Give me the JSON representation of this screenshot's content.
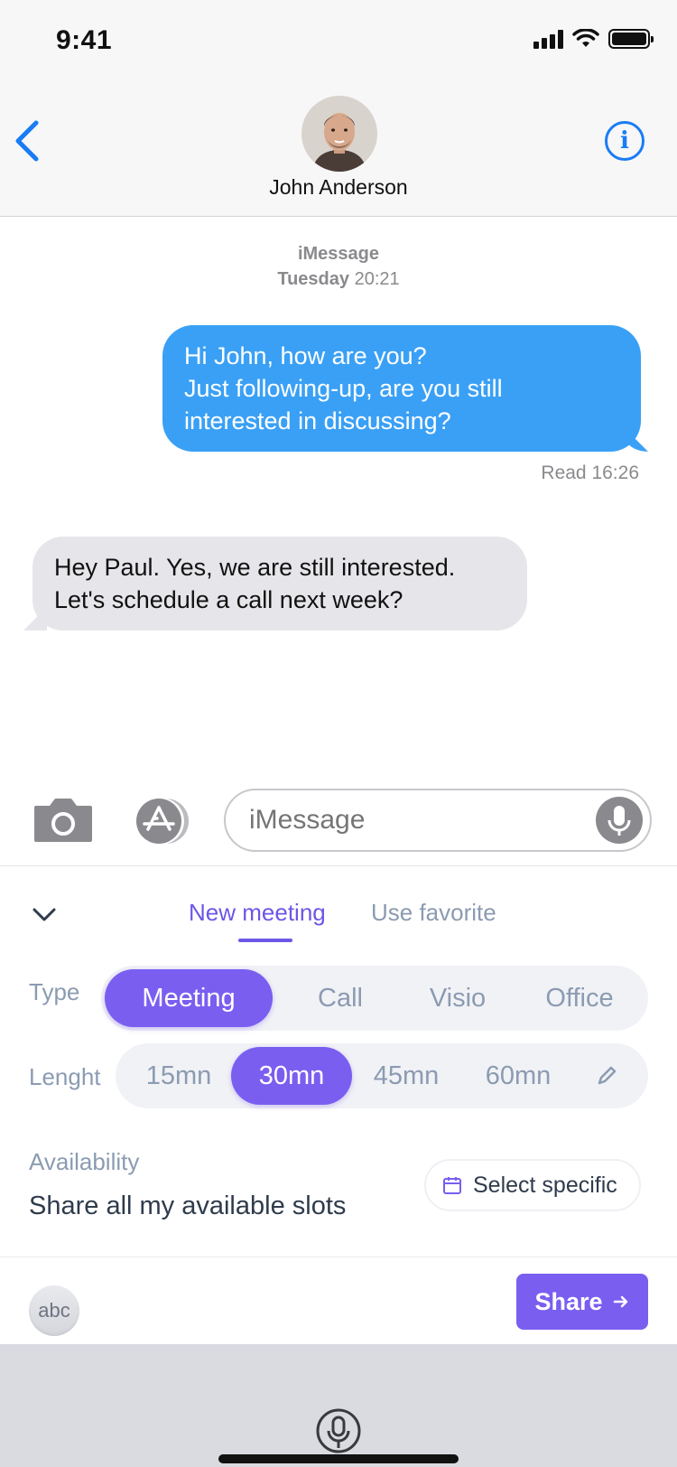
{
  "status_bar": {
    "time": "9:41"
  },
  "header": {
    "contact_name": "John Anderson",
    "back_icon": "chevron-left-icon",
    "info_icon": "info-icon",
    "info_glyph": "i"
  },
  "conversation": {
    "service": "iMessage",
    "day": "Tuesday",
    "time": "20:21",
    "outgoing_message": {
      "lines": [
        "Hi John, how are you?",
        "Just following-up, are you still",
        "interested in discussing?"
      ],
      "receipt": "Read 16:26"
    },
    "incoming_message": {
      "lines": [
        "Hey Paul. Yes, we are still interested.",
        "Let's schedule a call next week?"
      ]
    }
  },
  "composer": {
    "placeholder": "iMessage"
  },
  "meeting_panel": {
    "tabs": [
      {
        "label": "New meeting",
        "active": true
      },
      {
        "label": "Use favorite",
        "active": false
      }
    ],
    "type": {
      "label": "Type",
      "options": [
        "Meeting",
        "Call",
        "Visio",
        "Office"
      ],
      "selected": "Meeting"
    },
    "length": {
      "label": "Lenght",
      "options": [
        "15mn",
        "30mn",
        "45mn",
        "60mn"
      ],
      "selected": "30mn"
    },
    "availability": {
      "label": "Availability",
      "value": "Share all my available slots",
      "select_button": "Select specific"
    },
    "keyboard_toggle": "abc",
    "share_button": "Share",
    "accent_color": "#7a5ef0"
  },
  "colors": {
    "outgoing_bubble": "#3aa0f5",
    "incoming_bubble": "#e6e6ea",
    "ios_blue": "#1a7cf5"
  }
}
